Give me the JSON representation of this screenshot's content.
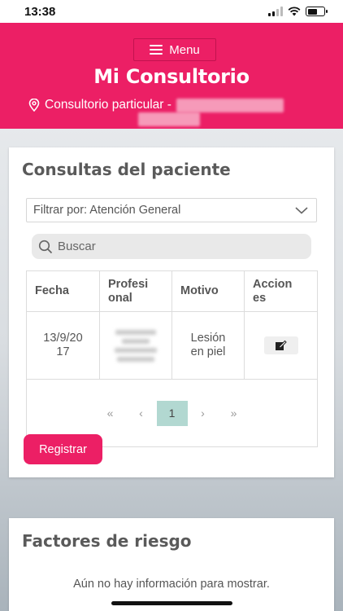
{
  "status_bar": {
    "time": "13:38"
  },
  "header": {
    "menu_label": "Menu",
    "title": "Mi Consultorio",
    "consultorio_label": "Consultorio particular -"
  },
  "consultas": {
    "title": "Consultas del paciente",
    "filter_value": "Filtrar por: Atención General",
    "search_placeholder": "Buscar",
    "columns": [
      "Fecha",
      "Profesional",
      "Motivo",
      "Acciones"
    ],
    "column_labels": {
      "fecha": "Fecha",
      "profesional_l1": "Profesi",
      "profesional_l2": "onal",
      "motivo": "Motivo",
      "acciones_l1": "Accion",
      "acciones_l2": "es"
    },
    "rows": [
      {
        "fecha_l1": "13/9/20",
        "fecha_l2": "17",
        "motivo_l1": "Lesión",
        "motivo_l2": "en piel"
      }
    ],
    "pagination": {
      "first": "«",
      "prev": "‹",
      "current": "1",
      "next": "›",
      "last": "»"
    },
    "register_label": "Registrar"
  },
  "factores": {
    "title": "Factores de riesgo",
    "empty_message": "Aún no hay información para mostrar."
  },
  "colors": {
    "brand": "#ec1f65",
    "page_active": "#b2d8d1"
  }
}
